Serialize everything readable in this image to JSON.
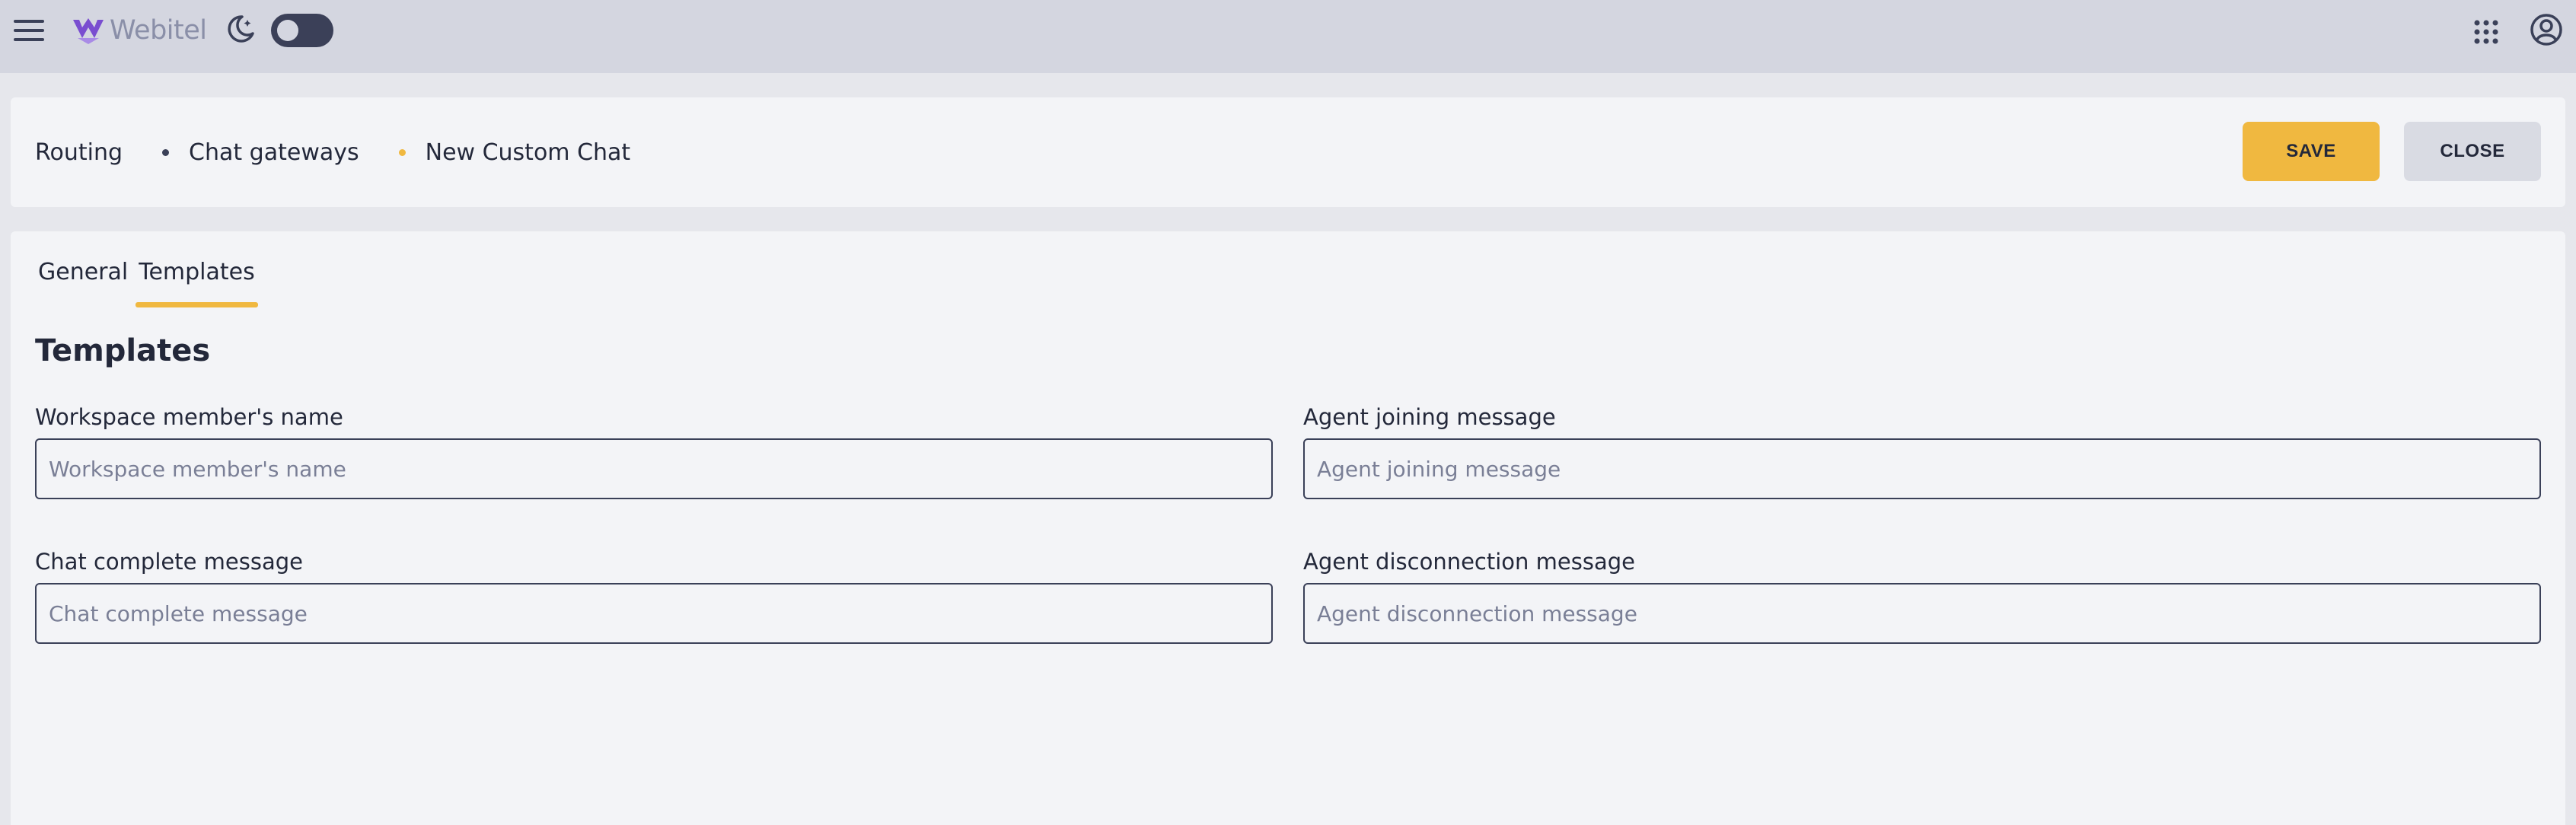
{
  "app": {
    "name": "Webitel"
  },
  "breadcrumb": [
    "Routing",
    "Chat gateways",
    "New Custom Chat"
  ],
  "actions": {
    "save_label": "SAVE",
    "close_label": "CLOSE"
  },
  "tabs": [
    {
      "label": "General",
      "active": false
    },
    {
      "label": "Templates",
      "active": true
    }
  ],
  "section": {
    "title": "Templates"
  },
  "fields": [
    {
      "label": "Workspace member's name",
      "placeholder": "Workspace member's name",
      "value": ""
    },
    {
      "label": "Agent joining message",
      "placeholder": "Agent joining message",
      "value": ""
    },
    {
      "label": "Chat complete message",
      "placeholder": "Chat complete message",
      "value": ""
    },
    {
      "label": "Agent disconnection message",
      "placeholder": "Agent disconnection message",
      "value": ""
    }
  ],
  "colors": {
    "accent": "#f0b840",
    "topbar": "#d4d6e0",
    "panel": "#f3f4f7",
    "text": "#23283a",
    "logo": "#7a4ed0"
  },
  "icons": [
    "menu-icon",
    "webitel-logo-icon",
    "moon-icon",
    "theme-toggle",
    "apps-grid-icon",
    "user-account-icon"
  ]
}
